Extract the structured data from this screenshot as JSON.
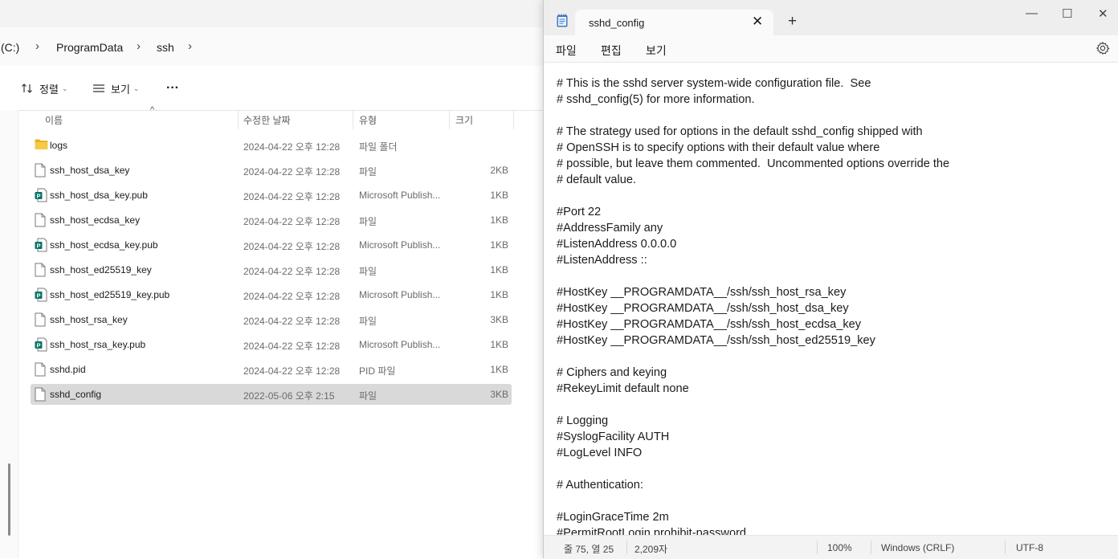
{
  "explorer": {
    "breadcrumb": [
      "(C:)",
      "ProgramData",
      "ssh"
    ],
    "toolbar": {
      "sort_label": "정렬",
      "view_label": "보기",
      "more_label": "···"
    },
    "columns": {
      "name": "이름",
      "date": "수정한 날짜",
      "type": "유형",
      "size": "크기"
    },
    "files": [
      {
        "name": "logs",
        "date": "2024-04-22 오후 12:28",
        "type": "파일 폴더",
        "size": "",
        "icon": "folder-icon"
      },
      {
        "name": "ssh_host_dsa_key",
        "date": "2024-04-22 오후 12:28",
        "type": "파일",
        "size": "2KB",
        "icon": "file-icon"
      },
      {
        "name": "ssh_host_dsa_key.pub",
        "date": "2024-04-22 오후 12:28",
        "type": "Microsoft Publish...",
        "size": "1KB",
        "icon": "publisher-file-icon"
      },
      {
        "name": "ssh_host_ecdsa_key",
        "date": "2024-04-22 오후 12:28",
        "type": "파일",
        "size": "1KB",
        "icon": "file-icon"
      },
      {
        "name": "ssh_host_ecdsa_key.pub",
        "date": "2024-04-22 오후 12:28",
        "type": "Microsoft Publish...",
        "size": "1KB",
        "icon": "publisher-file-icon"
      },
      {
        "name": "ssh_host_ed25519_key",
        "date": "2024-04-22 오후 12:28",
        "type": "파일",
        "size": "1KB",
        "icon": "file-icon"
      },
      {
        "name": "ssh_host_ed25519_key.pub",
        "date": "2024-04-22 오후 12:28",
        "type": "Microsoft Publish...",
        "size": "1KB",
        "icon": "publisher-file-icon"
      },
      {
        "name": "ssh_host_rsa_key",
        "date": "2024-04-22 오후 12:28",
        "type": "파일",
        "size": "3KB",
        "icon": "file-icon"
      },
      {
        "name": "ssh_host_rsa_key.pub",
        "date": "2024-04-22 오후 12:28",
        "type": "Microsoft Publish...",
        "size": "1KB",
        "icon": "publisher-file-icon"
      },
      {
        "name": "sshd.pid",
        "date": "2024-04-22 오후 12:28",
        "type": "PID 파일",
        "size": "1KB",
        "icon": "file-icon"
      },
      {
        "name": "sshd_config",
        "date": "2022-05-06 오후 2:15",
        "type": "파일",
        "size": "3KB",
        "icon": "file-icon",
        "selected": true
      }
    ]
  },
  "notepad": {
    "tab_title": "sshd_config",
    "menu": [
      "파일",
      "편집",
      "보기"
    ],
    "lines": [
      "# This is the sshd server system-wide configuration file.  See",
      "# sshd_config(5) for more information.",
      "",
      "# The strategy used for options in the default sshd_config shipped with",
      "# OpenSSH is to specify options with their default value where",
      "# possible, but leave them commented.  Uncommented options override the",
      "# default value.",
      "",
      "#Port 22",
      "#AddressFamily any",
      "#ListenAddress 0.0.0.0",
      "#ListenAddress ::",
      "",
      "#HostKey __PROGRAMDATA__/ssh/ssh_host_rsa_key",
      "#HostKey __PROGRAMDATA__/ssh/ssh_host_dsa_key",
      "#HostKey __PROGRAMDATA__/ssh/ssh_host_ecdsa_key",
      "#HostKey __PROGRAMDATA__/ssh/ssh_host_ed25519_key",
      "",
      "# Ciphers and keying",
      "#RekeyLimit default none",
      "",
      "# Logging",
      "#SyslogFacility AUTH",
      "#LogLevel INFO",
      "",
      "# Authentication:",
      "",
      "#LoginGraceTime 2m",
      "#PermitRootLogin prohibit-password"
    ],
    "status": {
      "position": "줄 75, 열 25",
      "chars": "2,209자",
      "zoom": "100%",
      "line_ending": "Windows (CRLF)",
      "encoding": "UTF-8"
    }
  }
}
